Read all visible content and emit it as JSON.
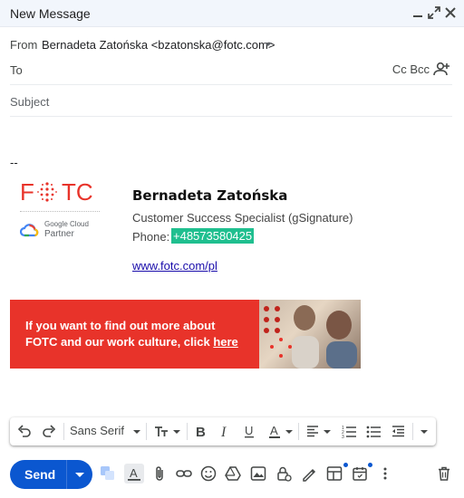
{
  "window": {
    "title": "New Message"
  },
  "compose": {
    "from_label": "From",
    "from_value": "Bernadeta Zatońska <bzatonska@fotc.com>",
    "to_label": "To",
    "cc_bcc": "Cc Bcc",
    "subject_placeholder": "Subject"
  },
  "body": {
    "separator": "--",
    "signature": {
      "logo_text": "F⁘TC",
      "partner_line1": "Google Cloud",
      "partner_line2": "Partner",
      "name": "Bernadeta Zatońska",
      "role": "Customer Success Specialist (gSignature)",
      "phone_label": "Phone:",
      "phone": "+48573580425",
      "website": "www.fotc.com/pl"
    },
    "banner": {
      "line1": "If you want to find out more about",
      "line2_prefix": "FOTC and our work culture, click ",
      "link": "here"
    }
  },
  "format_toolbar": {
    "font": "Sans Serif"
  },
  "actions": {
    "send_label": "Send"
  },
  "colors": {
    "brand_red": "#e8332a",
    "send_blue": "#0b57d0",
    "phone_highlight": "#1fbf8f"
  }
}
